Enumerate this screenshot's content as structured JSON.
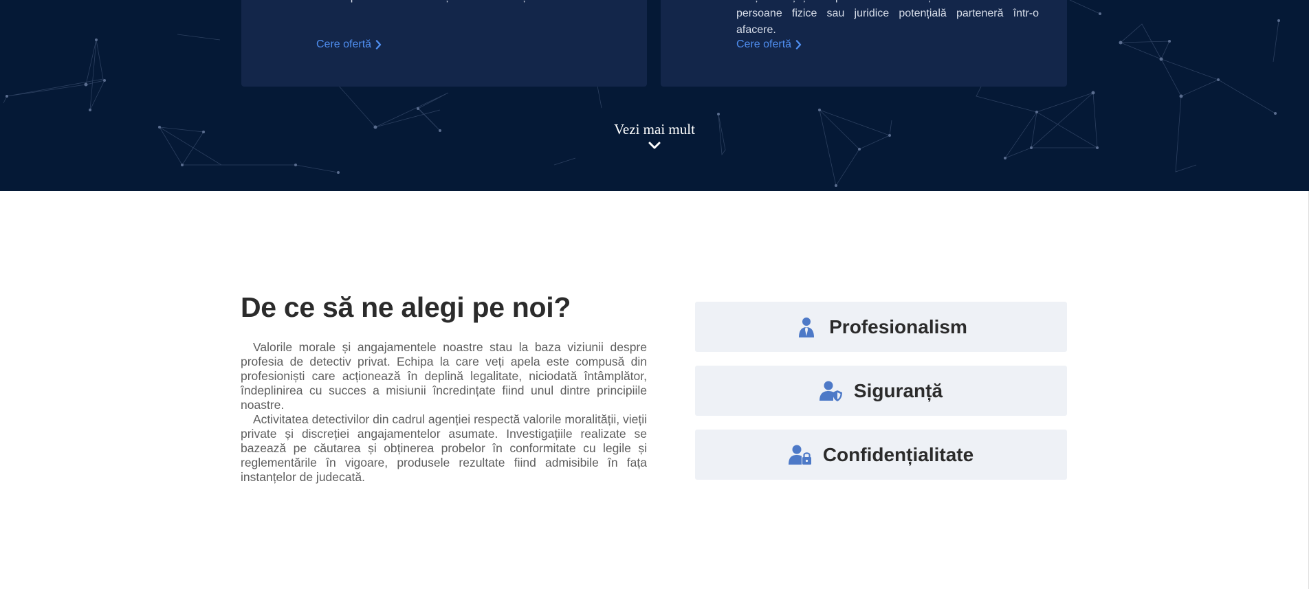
{
  "colors": {
    "hero_background": "#051936",
    "card_background": "#13264a",
    "link": "#4f8ef0",
    "feature_background": "#eef1f6",
    "feature_icon": "#4d79c7",
    "heading_text": "#2b2b2b",
    "body_text": "#5e5e5e"
  },
  "hero": {
    "cards": [
      {
        "text": "Noi vă putem oferi informațiile de care aveți nevoie.",
        "link_label": "Cere ofertă",
        "link_icon": "chevron-right-icon"
      },
      {
        "text": "doriți să știți despre seriozitatea și solvabilitatea unei persoane fizice sau juridice potențială parteneră într-o afacere.",
        "link_label": "Cere ofertă",
        "link_icon": "chevron-right-icon"
      }
    ],
    "see_more_label": "Vezi mai mult",
    "see_more_icon": "chevron-down-icon"
  },
  "why_us": {
    "title": "De ce să ne alegi pe noi?",
    "paragraphs": [
      "Valorile morale și angajamentele noastre stau la baza viziunii despre profesia de detectiv privat. Echipa la care veți apela este compusă din profesioniști care acționează în deplină legalitate, niciodată întâmplător, îndeplinirea cu succes a misiunii încredințate fiind unul dintre principiile noastre.",
      "Activitatea detectivilor din cadrul agenției respectă valorile moralității, vieții private și discreției angajamentelor asumate. Investigațiile realizate se bazează pe căutarea și obținerea probelor în conformitate cu legile și reglementările în vigoare, produsele rezultate fiind admisibile în fața instanțelor de judecată."
    ],
    "features": [
      {
        "label": "Profesionalism",
        "icon": "user-tie-icon"
      },
      {
        "label": "Siguranță",
        "icon": "user-shield-icon"
      },
      {
        "label": "Confidențialitate",
        "icon": "user-lock-icon"
      }
    ]
  }
}
